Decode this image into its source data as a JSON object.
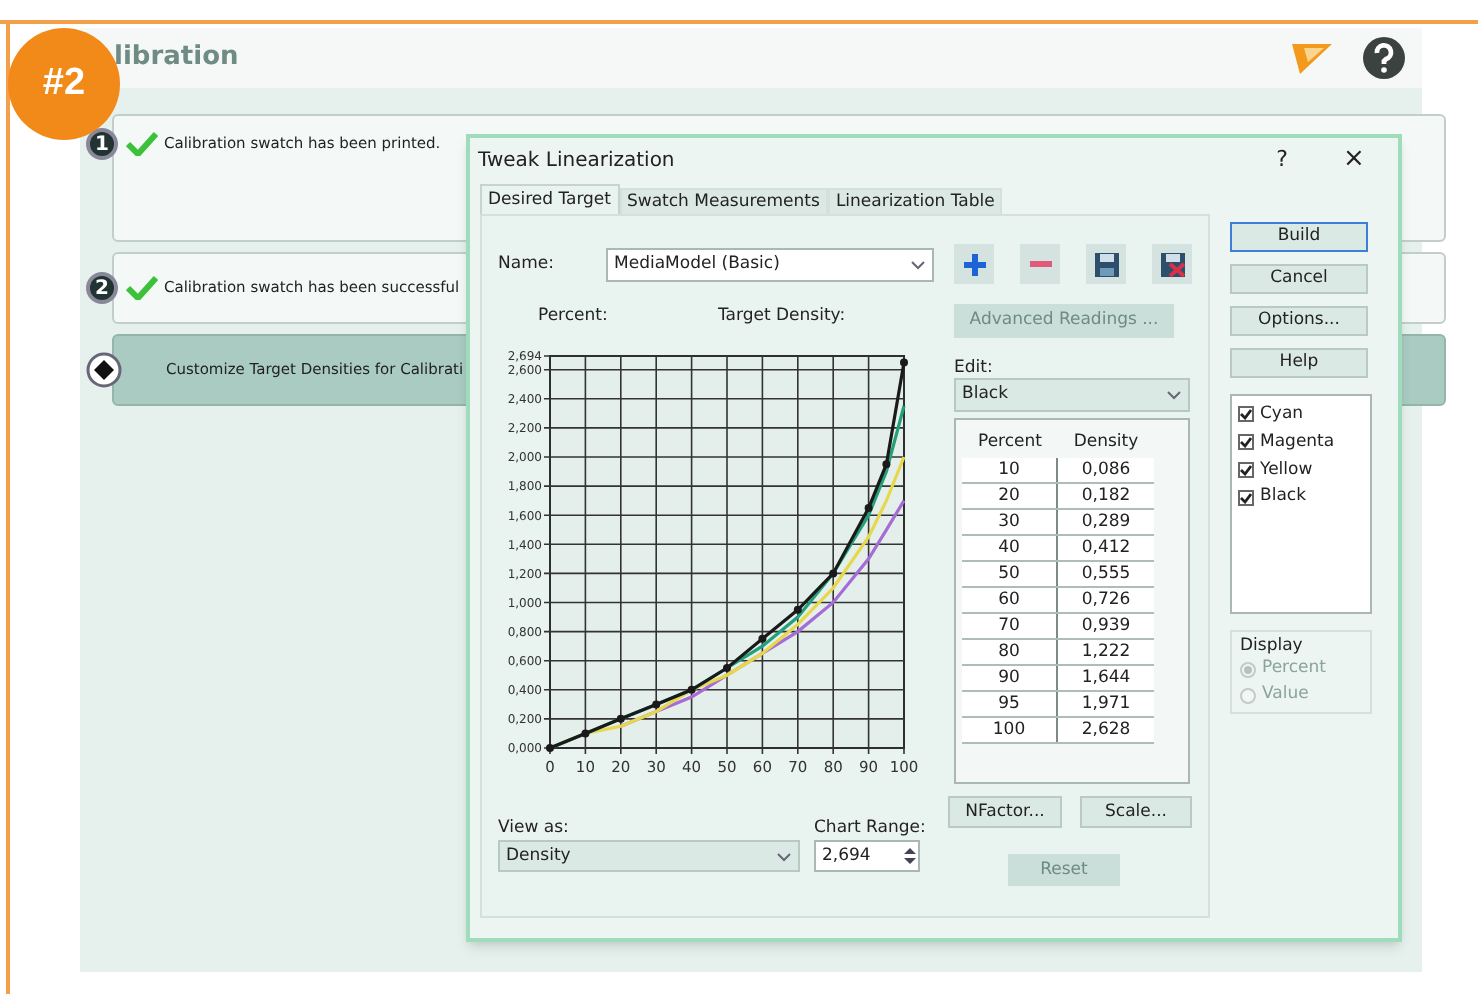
{
  "badge": "#2",
  "page": {
    "title": "libration"
  },
  "steps": [
    {
      "kind": "completed",
      "number": "1",
      "text": "Calibration swatch has been printed.",
      "selected": false
    },
    {
      "kind": "completed",
      "number": "2",
      "text": "Calibration swatch has been successful",
      "selected": false
    },
    {
      "kind": "current",
      "text": "Customize Target Densities for Calibrati",
      "selected": true
    }
  ],
  "dialog": {
    "title": "Tweak Linearization",
    "help_glyph": "?",
    "close_glyph": "×",
    "tabs": [
      {
        "label": "Desired Target",
        "selected": true
      },
      {
        "label": "Swatch Measurements",
        "selected": false
      },
      {
        "label": "Linearization Table",
        "selected": false
      }
    ],
    "name_label": "Name:",
    "name_value": "MediaModel (Basic)",
    "advanced_readings": {
      "label": "Advanced Readings ...",
      "disabled": true
    },
    "percent_label": "Percent:",
    "target_density_label": "Target Density:",
    "chart_data": {
      "type": "line",
      "x": [
        0,
        10,
        20,
        30,
        40,
        50,
        60,
        70,
        80,
        90,
        95,
        100
      ],
      "series": [
        {
          "color": "#a66bd6",
          "values": [
            null,
            null,
            0.15,
            0.25,
            0.35,
            0.5,
            0.65,
            0.8,
            1.0,
            1.3,
            1.5,
            1.7
          ]
        },
        {
          "color": "#e6d84a",
          "values": [
            0,
            0.1,
            0.15,
            0.25,
            0.4,
            0.5,
            0.65,
            0.85,
            1.1,
            1.45,
            1.7,
            2.0
          ]
        },
        {
          "color": "#22a07a",
          "values": [
            0,
            0.1,
            0.2,
            0.3,
            0.4,
            0.55,
            0.7,
            0.9,
            1.2,
            1.6,
            1.9,
            2.35
          ]
        },
        {
          "color": "#1a1a1a",
          "marker": "circle",
          "values": [
            0,
            0.1,
            0.2,
            0.3,
            0.4,
            0.55,
            0.75,
            0.95,
            1.2,
            1.65,
            1.95,
            2.65
          ]
        }
      ],
      "grid": true,
      "xlim": [
        0,
        100
      ],
      "ylim": [
        0,
        2.694
      ],
      "xticks": [
        0,
        10,
        20,
        30,
        40,
        50,
        60,
        70,
        80,
        90,
        100
      ],
      "yticks": [
        {
          "value": 0,
          "label": "0,000"
        },
        {
          "value": 0.2,
          "label": "0,200"
        },
        {
          "value": 0.4,
          "label": "0,400"
        },
        {
          "value": 0.6,
          "label": "0,600"
        },
        {
          "value": 0.8,
          "label": "0,800"
        },
        {
          "value": 1.0,
          "label": "1,000"
        },
        {
          "value": 1.2,
          "label": "1,200"
        },
        {
          "value": 1.4,
          "label": "1,400"
        },
        {
          "value": 1.6,
          "label": "1,600"
        },
        {
          "value": 1.8,
          "label": "1,800"
        },
        {
          "value": 2.0,
          "label": "2,000"
        },
        {
          "value": 2.2,
          "label": "2,200"
        },
        {
          "value": 2.4,
          "label": "2,400"
        },
        {
          "value": 2.6,
          "label": "2,600"
        },
        {
          "value": 2.694,
          "label": "2,694"
        }
      ]
    },
    "view_as_label": "View as:",
    "view_as_value": "Density",
    "chart_range_label": "Chart Range:",
    "chart_range_value": "2,694",
    "edit_label": "Edit:",
    "edit_value": "Black",
    "table": {
      "columns": [
        "Percent",
        "Density"
      ],
      "rows": [
        [
          "10",
          "0,086"
        ],
        [
          "20",
          "0,182"
        ],
        [
          "30",
          "0,289"
        ],
        [
          "40",
          "0,412"
        ],
        [
          "50",
          "0,555"
        ],
        [
          "60",
          "0,726"
        ],
        [
          "70",
          "0,939"
        ],
        [
          "80",
          "1,222"
        ],
        [
          "90",
          "1,644"
        ],
        [
          "95",
          "1,971"
        ],
        [
          "100",
          "2,628"
        ]
      ]
    },
    "nfactor": {
      "label": "NFactor...",
      "disabled": false
    },
    "scale": {
      "label": "Scale...",
      "disabled": false
    },
    "reset": {
      "label": "Reset",
      "disabled": true
    },
    "side_buttons": [
      {
        "label": "Build",
        "default": true
      },
      {
        "label": "Cancel",
        "default": false
      },
      {
        "label": "Options...",
        "default": false
      },
      {
        "label": "Help",
        "default": false
      }
    ],
    "channels": [
      {
        "label": "Cyan",
        "checked": true
      },
      {
        "label": "Magenta",
        "checked": true
      },
      {
        "label": "Yellow",
        "checked": true
      },
      {
        "label": "Black",
        "checked": true
      }
    ],
    "display": {
      "label": "Display",
      "disabled": true,
      "options": [
        {
          "label": "Percent",
          "selected": true
        },
        {
          "label": "Value",
          "selected": false
        }
      ]
    }
  }
}
